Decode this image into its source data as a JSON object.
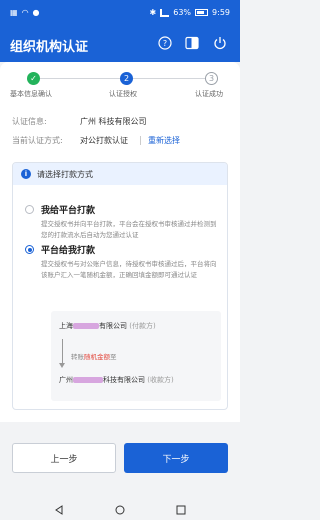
{
  "status_bar": {
    "time": "9:59",
    "battery": "63%"
  },
  "header": {
    "title": "组织机构认证"
  },
  "steps": [
    {
      "label": "基本信息确认",
      "state": "done",
      "number": "1"
    },
    {
      "label": "认证授权",
      "state": "current",
      "number": "2"
    },
    {
      "label": "认证成功",
      "state": "todo",
      "number": "3"
    }
  ],
  "auth_info": {
    "label": "认证信息:",
    "value": "广州                科技有限公司",
    "method_label": "当前认证方式:",
    "method_value": "对公打款认证",
    "reselect_label": "重新选择"
  },
  "payment_panel": {
    "heading": "请选择打款方式",
    "option_1": {
      "title": "我给平台打款",
      "description": "提交授权书并向平台打款，平台会在授权书审核通过并检测到您的打款流水后自动为您通过认证",
      "selected": false
    },
    "option_2": {
      "title": "平台给我打款",
      "description": "提交授权书与对公账户信息，待授权书审核通过后，平台将向该账户汇入一笔随机金额，正确回填金额即可通过认证",
      "selected": true
    },
    "flow": {
      "from_prefix": "上海",
      "from_suffix": "有限公司",
      "from_tag": "(付款方)",
      "transfer_prefix": "转账",
      "transfer_highlight": "随机金额",
      "transfer_suffix": "至",
      "to_prefix": "广州",
      "to_suffix": "科技有限公司",
      "to_tag": "(收款方)"
    }
  },
  "buttons": {
    "prev": "上一步",
    "next": "下一步"
  },
  "colors": {
    "primary": "#1a62d6",
    "success": "#23b35b",
    "highlight": "#e2483d"
  }
}
